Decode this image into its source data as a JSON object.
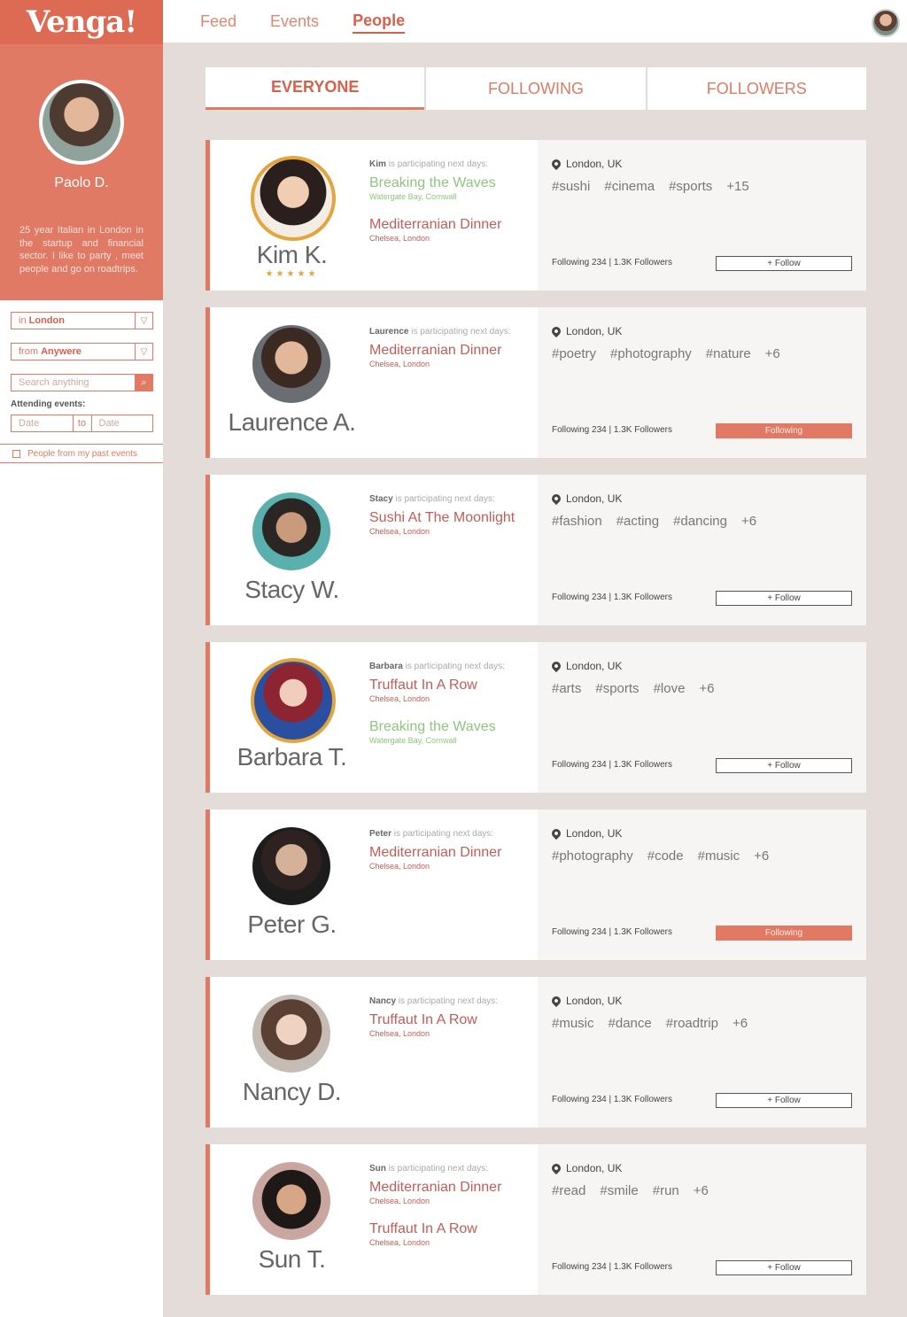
{
  "app": {
    "logo": "Venga!"
  },
  "nav": {
    "feed": "Feed",
    "events": "Events",
    "people": "People"
  },
  "profile": {
    "name": "Paolo D.",
    "bio": "25 year Italian in London in the startup and financial sector. I like to party , meet people and go on roadtrips."
  },
  "filters": {
    "location_prefix": "in",
    "location_value": "London",
    "origin_prefix": "from",
    "origin_value": "Anywere",
    "search_placeholder": "Search anything",
    "attending_label": "Attending events:",
    "date_from_placeholder": "Date",
    "date_to_label": "to",
    "date_to_placeholder": "Date",
    "past_events_label": "People from my past events"
  },
  "tabs": {
    "everyone": "EVERYONE",
    "following": "FOLLOWING",
    "followers": "FOLLOWERS"
  },
  "colors": {
    "accent": "#e07a64",
    "green_event": "#8ec67b",
    "ring": "#e3a53c"
  },
  "people": [
    {
      "name": "Kim K.",
      "first": "Kim",
      "participating_suffix": "is participating next days:",
      "stars": "★★★★★",
      "events": [
        {
          "title": "Breaking the Waves",
          "location": "Watergate Bay, Cornwall",
          "color": "green"
        },
        {
          "title": "Mediterranian Dinner",
          "location": "Chelsea, London",
          "color": "red"
        }
      ],
      "city": "London, UK",
      "tags": [
        "#sushi",
        "#cinema",
        "#sports",
        "+15"
      ],
      "stats": "Following 234  |  1.3K Followers",
      "follow_label": "+ Follow",
      "following": false
    },
    {
      "name": "Laurence A.",
      "first": "Laurence",
      "participating_suffix": "is participating next days:",
      "events": [
        {
          "title": "Mediterranian Dinner",
          "location": "Chelsea, London",
          "color": "red"
        }
      ],
      "city": "London, UK",
      "tags": [
        "#poetry",
        "#photography",
        "#nature",
        "+6"
      ],
      "stats": "Following 234  |  1.3K Followers",
      "follow_label": "Following",
      "following": true
    },
    {
      "name": "Stacy W.",
      "first": "Stacy",
      "participating_suffix": "is participating next days:",
      "events": [
        {
          "title": "Sushi At The Moonlight",
          "location": "Chelsea, London",
          "color": "red"
        }
      ],
      "city": "London, UK",
      "tags": [
        "#fashion",
        "#acting",
        "#dancing",
        "+6"
      ],
      "stats": "Following 234  |  1.3K Followers",
      "follow_label": "+ Follow",
      "following": false
    },
    {
      "name": "Barbara T.",
      "first": "Barbara",
      "participating_suffix": "is participating next days:",
      "events": [
        {
          "title": "Truffaut In A Row",
          "location": "Chelsea, London",
          "color": "red"
        },
        {
          "title": "Breaking the Waves",
          "location": "Watergate Bay, Cornwall",
          "color": "green"
        }
      ],
      "city": "London, UK",
      "tags": [
        "#arts",
        "#sports",
        "#love",
        "+6"
      ],
      "stats": "Following 234  |  1.3K Followers",
      "follow_label": "+ Follow",
      "following": false
    },
    {
      "name": "Peter G.",
      "first": "Peter",
      "participating_suffix": "is participating next days:",
      "events": [
        {
          "title": "Mediterranian Dinner",
          "location": "Chelsea, London",
          "color": "red"
        }
      ],
      "city": "London, UK",
      "tags": [
        "#photography",
        "#code",
        "#music",
        "+6"
      ],
      "stats": "Following 234  |  1.3K Followers",
      "follow_label": "Following",
      "following": true
    },
    {
      "name": "Nancy D.",
      "first": "Nancy",
      "participating_suffix": "is participating next days:",
      "events": [
        {
          "title": "Truffaut In A Row",
          "location": "Chelsea, London",
          "color": "red"
        }
      ],
      "city": "London, UK",
      "tags": [
        "#music",
        "#dance",
        "#roadtrip",
        "+6"
      ],
      "stats": "Following 234  |  1.3K Followers",
      "follow_label": "+ Follow",
      "following": false
    },
    {
      "name": "Sun T.",
      "first": "Sun",
      "participating_suffix": "is participating next days:",
      "events": [
        {
          "title": "Mediterranian Dinner",
          "location": "Chelsea, London",
          "color": "red"
        },
        {
          "title": "Truffaut In A Row",
          "location": "Chelsea, London",
          "color": "red"
        }
      ],
      "city": "London, UK",
      "tags": [
        "#read",
        "#smile",
        "#run",
        "+6"
      ],
      "stats": "Following 234  |  1.3K Followers",
      "follow_label": "+ Follow",
      "following": false
    }
  ]
}
